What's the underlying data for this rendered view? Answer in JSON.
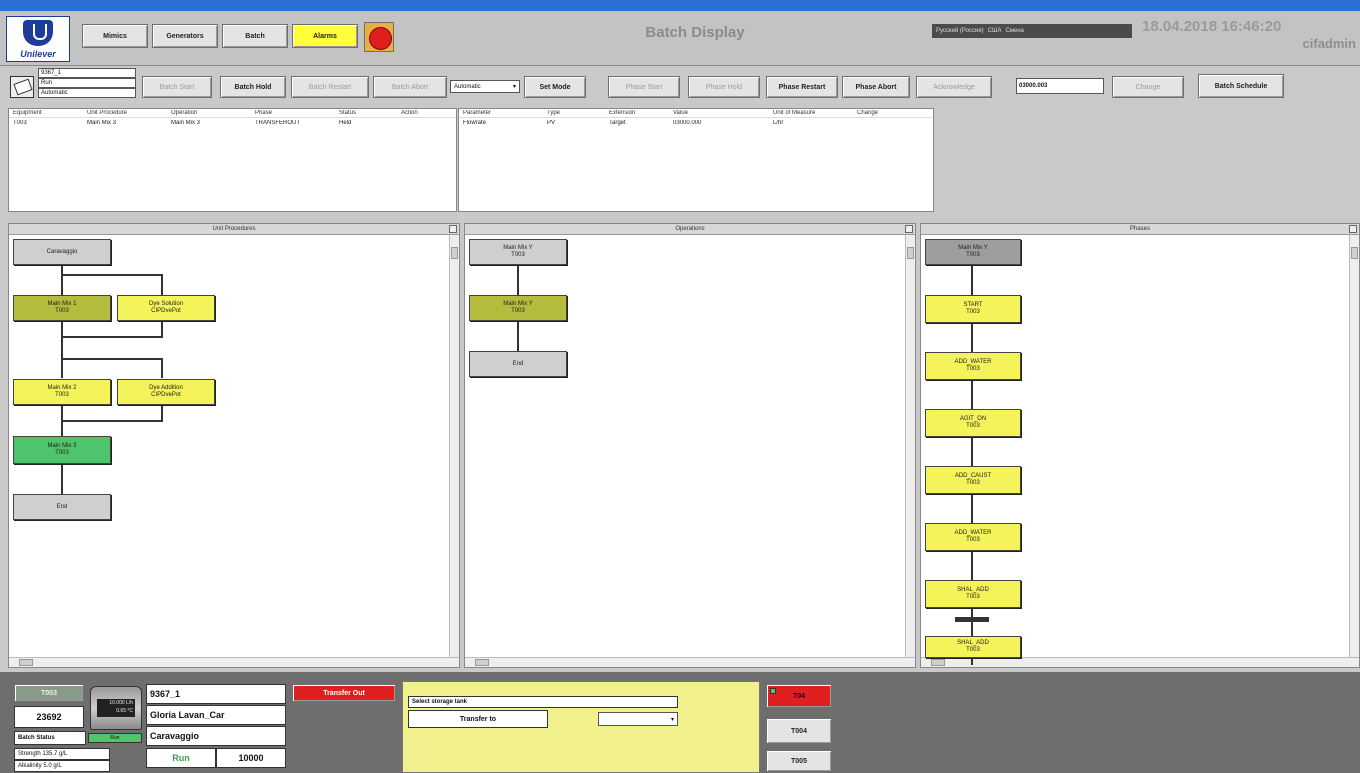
{
  "header": {
    "logo_text": "Unilever",
    "nav": [
      "Mimics",
      "Generators",
      "Batch",
      "Alarms"
    ],
    "title": "Batch Display",
    "lang_bar": [
      "Русский (Россия)",
      "США",
      "Сменa"
    ],
    "datetime": "18.04.2018 16:46:20",
    "user": "cifadmin"
  },
  "batch_info": {
    "id": "9367_1",
    "state": "Run",
    "mode": "Automatic"
  },
  "controls": {
    "batch_start": "Batch Start",
    "batch_hold": "Batch Hold",
    "batch_restart": "Batch Restart",
    "batch_abort": "Batch Abort",
    "mode_select": "Automatic",
    "set_mode": "Set Mode",
    "phase_start": "Phase Start",
    "phase_hold": "Phase Hold",
    "phase_restart": "Phase Restart",
    "phase_abort": "Phase Abort",
    "acknowledge": "Acknowledge",
    "value_input": "03000.003",
    "change": "Change",
    "batch_schedule": "Batch Schedule"
  },
  "unit_table": {
    "headers": [
      "Equipment",
      "Unit Procedure",
      "Operation",
      "Phase",
      "Status",
      "Action"
    ],
    "rows": [
      [
        "T003",
        "Main Mix 3",
        "Main Mix 3",
        "TRANSFEROUT",
        "Held",
        ""
      ]
    ]
  },
  "param_table": {
    "headers": [
      "Parameter",
      "Type",
      "Extension",
      "Value",
      "Unit of Measure",
      "Change"
    ],
    "rows": [
      [
        "Flowrate",
        "PV",
        "Target",
        "03000.000",
        "L/hr",
        ""
      ]
    ]
  },
  "panes": {
    "unit_procedures": "Unit Procedures",
    "operations": "Operations",
    "phases": "Phases"
  },
  "unit_nodes": {
    "caravaggio": "Caravaggio",
    "mm1": [
      "Main Mix 1",
      "T003"
    ],
    "dye_solution": [
      "Dye Solution",
      "CIPDvePot"
    ],
    "mm2": [
      "Main Mix 2",
      "T003"
    ],
    "dye_addition": [
      "Dye Addition",
      "CIPDvePot"
    ],
    "mm3": [
      "Main Mix 3",
      "T003"
    ],
    "end": "End"
  },
  "op_nodes": {
    "top": [
      "Main Mix Y",
      "T003"
    ],
    "mid": [
      "Main Mix Y",
      "T003"
    ],
    "end": "End"
  },
  "phase_nodes": {
    "top": [
      "Main Mix Y",
      "T003"
    ],
    "list": [
      [
        "START",
        "T003"
      ],
      [
        "ADD_WATER",
        "T003"
      ],
      [
        "AGIT_ON",
        "T003"
      ],
      [
        "ADD_CAUST",
        "T003"
      ],
      [
        "ADD_WATER",
        "T003"
      ],
      [
        "SHAL_ADD",
        "T003"
      ],
      [
        "SHAL_ADD",
        "T003"
      ]
    ]
  },
  "bottom": {
    "tank_label": "T003",
    "tank_number": "23692",
    "tank_readout": [
      "10.000 L/h",
      "0.65 °C"
    ],
    "batch_status_label": "Batch Status",
    "batch_status_value": "Run",
    "strength": "Strength 135.7 g/L",
    "alkalinity": "Alkalinity 5.0 g/L",
    "batch_id": "9367_1",
    "product": "Gloria Lavan_Car",
    "recipe": "Caravaggio",
    "run_state": "Run",
    "quantity": "10000",
    "transfer_out": "Transfer Out",
    "select_tank": "Select storage tank",
    "transfer_to": "Transfer to",
    "tanks": [
      "T04",
      "T004",
      "T005"
    ]
  }
}
